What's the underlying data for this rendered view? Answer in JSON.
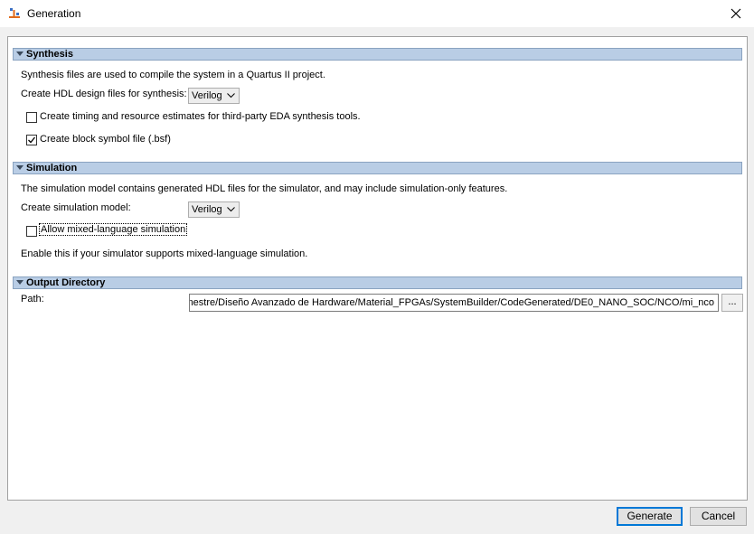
{
  "window": {
    "title": "Generation",
    "app_icon": "altera-qsys-icon",
    "close_icon": "close-icon"
  },
  "synthesis": {
    "title": "Synthesis",
    "description": "Synthesis files are used to compile the system in a Quartus II project.",
    "hdl_label": "Create HDL design files for synthesis:",
    "hdl_value": "Verilog",
    "timing_label": "Create timing and resource estimates for third-party EDA synthesis tools.",
    "timing_checked": false,
    "bsf_label": "Create block symbol file (.bsf)",
    "bsf_checked": true
  },
  "simulation": {
    "title": "Simulation",
    "description": "The simulation model contains generated HDL files for the simulator, and may include simulation-only features.",
    "model_label": "Create simulation model:",
    "model_value": "Verilog",
    "mixed_label": "Allow mixed-language simulation",
    "mixed_checked": false,
    "hint": "Enable this if your simulator supports mixed-language simulation."
  },
  "output": {
    "title": "Output Directory",
    "path_label": "Path:",
    "path_value": "Semestre/Diseño Avanzado de Hardware/Material_FPGAs/SystemBuilder/CodeGenerated/DE0_NANO_SOC/NCO/mi_nco",
    "browse_label": "..."
  },
  "buttons": {
    "generate": "Generate",
    "cancel": "Cancel"
  },
  "colors": {
    "section_header": "#b9cde5",
    "focus_border": "#0078d7"
  }
}
